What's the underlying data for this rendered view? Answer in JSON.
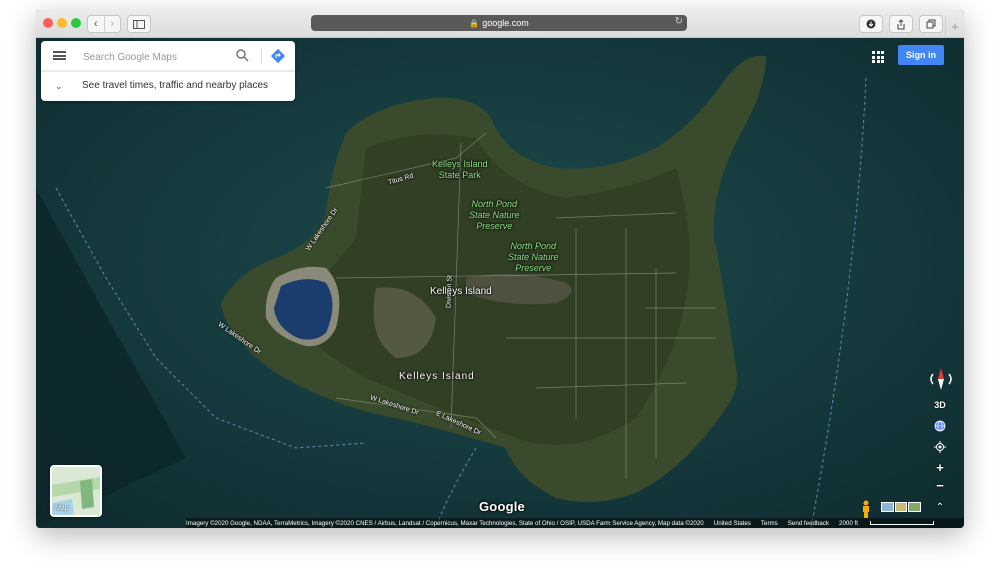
{
  "browser": {
    "url": "google.com",
    "back_label": "‹",
    "forward_label": "›",
    "newtab_label": "+"
  },
  "search": {
    "placeholder": "Search Google Maps",
    "subbar_label": "See travel times, traffic and nearby places"
  },
  "header": {
    "signin_label": "Sign in"
  },
  "map": {
    "labels": {
      "park": "Kelleys Island\nState Park",
      "preserve1": "North Pond\nState Nature\nPreserve",
      "preserve2": "North Pond\nState Nature\nPreserve",
      "place": "Kelleys Island",
      "town": "Kelleys Island",
      "road_titus": "Titus Rd",
      "road_wlake1": "W Lakeshore Dr",
      "road_wlake2": "W Lakeshore Dr",
      "road_wlake3": "W Lakeshore Dr",
      "road_elake": "E Lakeshore Dr",
      "road_division": "Division St"
    },
    "logo": "Google",
    "thumb_label": "Map",
    "tilt_label": "3D",
    "zoom_in_label": "+",
    "zoom_out_label": "−",
    "expand_label": "⌃"
  },
  "footer": {
    "attribution": "Imagery ©2020 Google, NDAA, TerraMetrics, Imagery ©2020 CNES / Airbus, Landsat / Copernicus, Maxar Technologies, State of Ohio / OSIP, USDA Farm Service Agency, Map data ©2020",
    "region": "United States",
    "terms": "Terms",
    "feedback": "Send feedback",
    "scale": "2000 ft"
  },
  "colors": {
    "water": "#163d41",
    "land": "#3a4a2c",
    "accent": "#4285f4"
  }
}
